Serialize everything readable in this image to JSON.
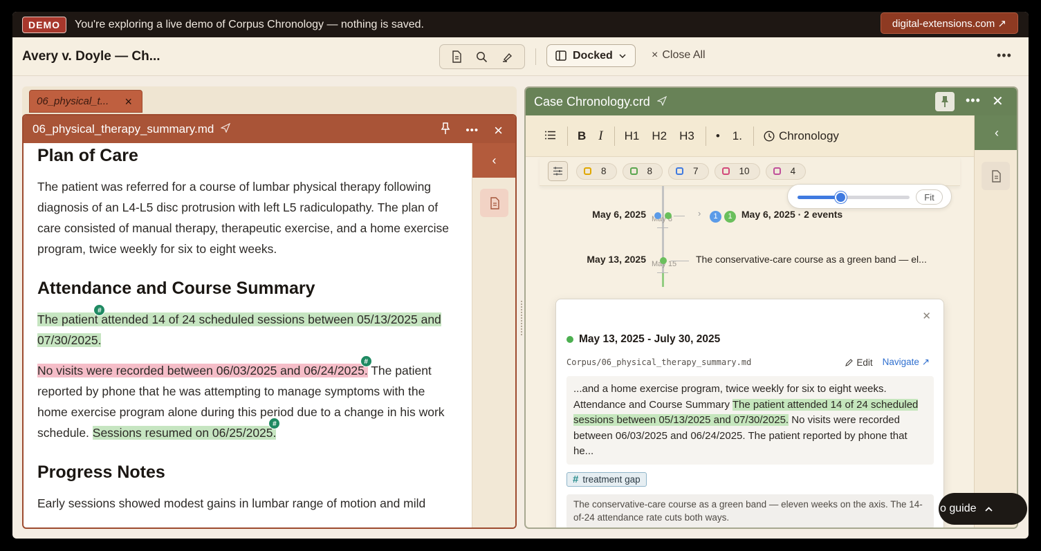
{
  "banner": {
    "badge": "DEMO",
    "text": "You're exploring a live demo of Corpus Chronology — nothing is saved.",
    "link": "digital-extensions.com ↗"
  },
  "topbar": {
    "title": "Avery v. Doyle — Ch...",
    "layout_label": "Docked",
    "close_all": "Close All"
  },
  "left": {
    "tab_label": "06_physical_t...",
    "panel_title": "06_physical_therapy_summary.md",
    "doc": {
      "h_plan": "Plan of Care",
      "p_plan": "The patient was referred for a course of lumbar physical therapy following diagnosis of an L4-L5 disc protrusion with left L5 radiculopathy. The plan of care consisted of manual therapy, therapeutic exercise, and a home exercise program, twice weekly for six to eight weeks.",
      "h_attendance": "Attendance and Course Summary",
      "p_attendance": "The patient attended 14 of 24 scheduled sessions between 05/13/2025 and 07/30/2025.",
      "p_gap_red": "No visits were recorded between 06/03/2025 and 06/24/2025.",
      "p_gap_rest": " The patient reported by phone that he was attempting to manage symptoms with the home exercise program alone during this period due to a change in his work schedule. ",
      "p_gap_green": "Sessions resumed on 06/25/2025.",
      "h_progress": "Progress Notes",
      "p_progress": "Early sessions showed modest gains in lumbar range of motion and mild"
    }
  },
  "right": {
    "panel_title": "Case Chronology.crd",
    "editbar": {
      "bold": "B",
      "italic": "I",
      "h1": "H1",
      "h2": "H2",
      "h3": "H3",
      "bullet": "•",
      "numbered": "1.",
      "chronology": "Chronology"
    },
    "chips": [
      {
        "color": "#e0a800",
        "count": "8"
      },
      {
        "color": "#5aa64f",
        "count": "8"
      },
      {
        "color": "#3f7ae0",
        "count": "7"
      },
      {
        "color": "#d2497a",
        "count": "10"
      },
      {
        "color": "#c04f9a",
        "count": "4"
      }
    ],
    "zoom": {
      "level": 0.38,
      "fit": "Fit"
    },
    "timeline": [
      {
        "date": "May 6, 2025",
        "sub": "May 8",
        "badge_blue": "1",
        "badge_green": "1",
        "label": "May 6, 2025 · 2 events"
      },
      {
        "date": "May 13, 2025",
        "sub": "May 15",
        "label": "The conservative-care course as a green band — el..."
      }
    ],
    "popup": {
      "range": "May 13, 2025 - July 30, 2025",
      "path": "Corpus/06_physical_therapy_summary.md",
      "edit": "Edit",
      "navigate": "Navigate ↗",
      "excerpt_pre": "...and a home exercise program, twice weekly for six to eight weeks. Attendance and Course Summary ",
      "excerpt_hl": "The patient attended 14 of 24 scheduled sessions between 05/13/2025 and 07/30/2025.",
      "excerpt_post": " No visits were recorded between 06/03/2025 and 06/24/2025. The patient reported by phone that he...",
      "tag": "treatment gap",
      "note": "The conservative-care course as a green band — eleven weeks on the axis. The 14-of-24 attendance rate cuts both ways."
    }
  },
  "guide": {
    "label": "o guide"
  }
}
